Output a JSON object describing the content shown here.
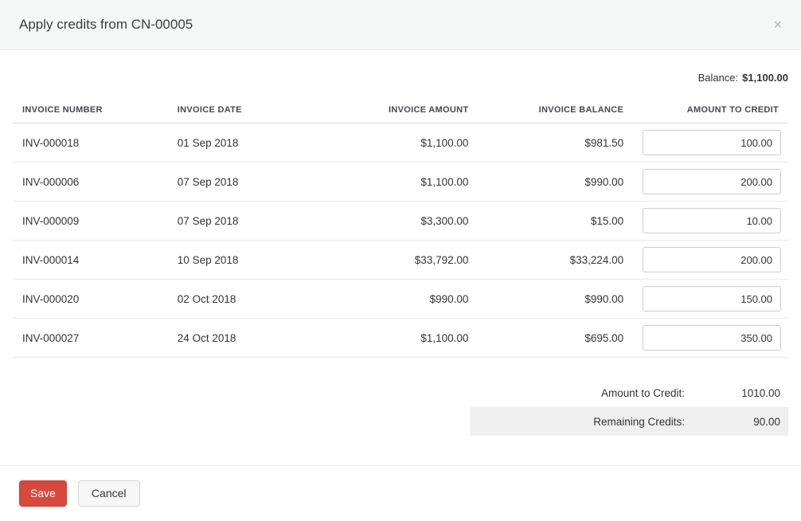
{
  "modal": {
    "title": "Apply credits from CN-00005",
    "close_icon": "×"
  },
  "balance": {
    "label": "Balance:",
    "value": "$1,100.00"
  },
  "table": {
    "headers": [
      "INVOICE NUMBER",
      "INVOICE DATE",
      "INVOICE AMOUNT",
      "INVOICE BALANCE",
      "AMOUNT TO CREDIT"
    ],
    "rows": [
      {
        "invoice_number": "INV-000018",
        "invoice_date": "01 Sep 2018",
        "invoice_amount": "$1,100.00",
        "invoice_balance": "$981.50",
        "amount_to_credit": "100.00"
      },
      {
        "invoice_number": "INV-000006",
        "invoice_date": "07 Sep 2018",
        "invoice_amount": "$1,100.00",
        "invoice_balance": "$990.00",
        "amount_to_credit": "200.00"
      },
      {
        "invoice_number": "INV-000009",
        "invoice_date": "07 Sep 2018",
        "invoice_amount": "$3,300.00",
        "invoice_balance": "$15.00",
        "amount_to_credit": "10.00"
      },
      {
        "invoice_number": "INV-000014",
        "invoice_date": "10 Sep 2018",
        "invoice_amount": "$33,792.00",
        "invoice_balance": "$33,224.00",
        "amount_to_credit": "200.00"
      },
      {
        "invoice_number": "INV-000020",
        "invoice_date": "02 Oct 2018",
        "invoice_amount": "$990.00",
        "invoice_balance": "$990.00",
        "amount_to_credit": "150.00"
      },
      {
        "invoice_number": "INV-000027",
        "invoice_date": "24 Oct 2018",
        "invoice_amount": "$1,100.00",
        "invoice_balance": "$695.00",
        "amount_to_credit": "350.00"
      }
    ]
  },
  "summary": {
    "amount_to_credit_label": "Amount to Credit:",
    "amount_to_credit_value": "1010.00",
    "remaining_credits_label": "Remaining Credits:",
    "remaining_credits_value": "90.00"
  },
  "footer": {
    "save_label": "Save",
    "cancel_label": "Cancel"
  },
  "colors": {
    "save_button": "#d9483b",
    "header_bg": "#f5f6f6",
    "remaining_row_bg": "#efefef"
  }
}
